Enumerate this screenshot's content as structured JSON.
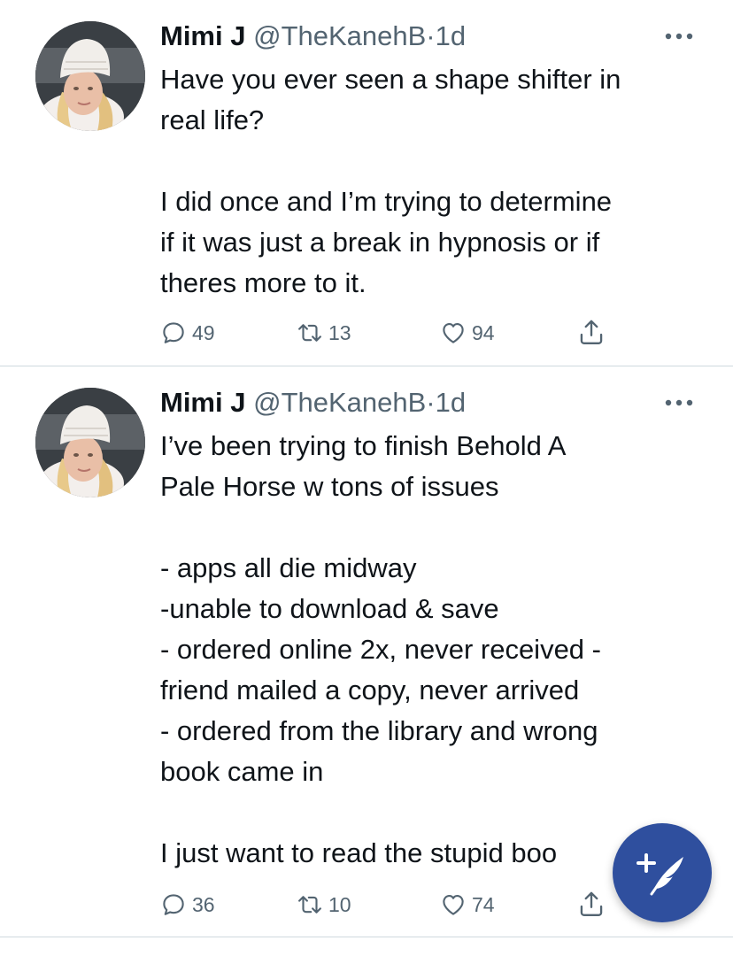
{
  "tweets": [
    {
      "display_name": "Mimi J",
      "handle": "@TheKanehB",
      "separator": "·",
      "time": "1d",
      "text": "Have you ever seen a shape shifter in\nreal life?\n\nI did once and I’m trying to determine\nif it was just a break in hypnosis or if\ntheres more to it.",
      "replies": "49",
      "retweets": "13",
      "likes": "94",
      "avatar_icon": "avatar",
      "more_icon": "more-horizontal-icon"
    },
    {
      "display_name": "Mimi J",
      "handle": "@TheKanehB",
      "separator": "·",
      "time": "1d",
      "text": "I’ve been trying to finish Behold A\nPale Horse w tons of issues\n\n- apps all die midway\n-unable to download & save\n- ordered online 2x, never received -\nfriend mailed a copy, never arrived\n- ordered from the library and wrong\nbook came in\n\nI just want to read the stupid boo",
      "replies": "36",
      "retweets": "10",
      "likes": "74",
      "avatar_icon": "avatar",
      "more_icon": "more-horizontal-icon"
    }
  ],
  "icons": {
    "reply": "reply-icon",
    "retweet": "retweet-icon",
    "like": "heart-icon",
    "share": "share-icon",
    "compose": "compose-tweet-icon"
  },
  "colors": {
    "text": "#0f1419",
    "secondary": "#536471",
    "divider": "#cfd9de",
    "fab": "#2f4f9e"
  }
}
